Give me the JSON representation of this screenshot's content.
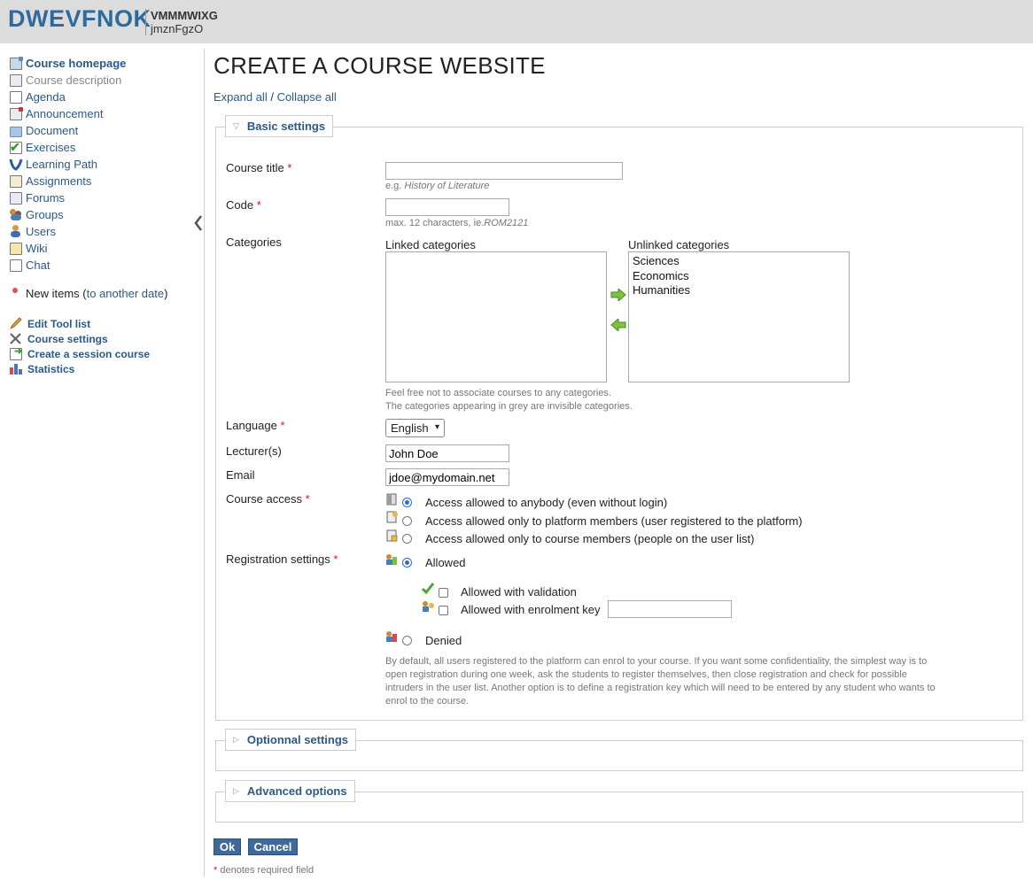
{
  "header": {
    "brand": "DWEVFNOK",
    "course_code": "VMMMWIXG",
    "course_name": "jmznFgzO"
  },
  "sidebar": {
    "tools": [
      {
        "label": "Course homepage",
        "icon": "home-icon"
      },
      {
        "label": "Course description",
        "icon": "description-icon"
      },
      {
        "label": "Agenda",
        "icon": "calendar-icon"
      },
      {
        "label": "Announcement",
        "icon": "announcement-icon"
      },
      {
        "label": "Document",
        "icon": "folder-icon"
      },
      {
        "label": "Exercises",
        "icon": "checkmark-icon"
      },
      {
        "label": "Learning Path",
        "icon": "learning-path-icon"
      },
      {
        "label": "Assignments",
        "icon": "assignment-icon"
      },
      {
        "label": "Forums",
        "icon": "forum-icon"
      },
      {
        "label": "Groups",
        "icon": "groups-icon"
      },
      {
        "label": "Users",
        "icon": "user-icon"
      },
      {
        "label": "Wiki",
        "icon": "wiki-icon"
      },
      {
        "label": "Chat",
        "icon": "chat-icon"
      }
    ],
    "new_items_label": "New items (",
    "new_items_link": "to another date",
    "new_items_close": ")",
    "admin": [
      {
        "label": "Edit Tool list",
        "icon": "pencil-icon"
      },
      {
        "label": "Course settings",
        "icon": "tools-icon"
      },
      {
        "label": "Create a session course",
        "icon": "session-course-icon"
      },
      {
        "label": "Statistics",
        "icon": "statistics-icon"
      }
    ]
  },
  "main": {
    "title": "CREATE A COURSE WEBSITE",
    "expand_all": "Expand all",
    "separator": " / ",
    "collapse_all": "Collapse all",
    "sections": {
      "basic": "Basic settings",
      "optional": "Optionnal settings",
      "advanced": "Advanced options"
    },
    "required_mark": "*",
    "fields": {
      "course_title": {
        "label": "Course title",
        "value": "",
        "hint_prefix": "e.g. ",
        "hint_example": "History of Literature"
      },
      "code": {
        "label": "Code",
        "value": "",
        "hint_prefix": "max. 12 characters, ie.",
        "hint_example": "ROM2121"
      },
      "categories": {
        "label": "Categories",
        "linked_label": "Linked categories",
        "unlinked_label": "Unlinked categories",
        "linked": [],
        "unlinked": [
          "Sciences",
          "Economics",
          "Humanities"
        ],
        "hint1": "Feel free not to associate courses to any categories.",
        "hint2": "The categories appearing in grey are invisible categories."
      },
      "language": {
        "label": "Language",
        "value": "English"
      },
      "lecturers": {
        "label": "Lecturer(s)",
        "value": "John Doe"
      },
      "email": {
        "label": "Email",
        "value": "jdoe@mydomain.net"
      },
      "course_access": {
        "label": "Course access",
        "options": [
          {
            "label": "Access allowed to anybody (even without login)",
            "checked": true
          },
          {
            "label": "Access allowed only to platform members (user registered to the platform)",
            "checked": false
          },
          {
            "label": "Access allowed only to course members (people on the user list)",
            "checked": false
          }
        ]
      },
      "registration": {
        "label": "Registration settings",
        "allowed": "Allowed",
        "allowed_checked": true,
        "with_validation": "Allowed with validation",
        "with_key": "Allowed with enrolment key",
        "key_value": "",
        "denied": "Denied",
        "description": "By default, all users registered to the platform can enrol to your course. If you want some confidentiality, the simplest way is to open registration during one week, ask the students to register themselves, then close registration and check for possible intruders in the user list. Another option is to define a registration key which will need to be entered by any student who wants to enrol to the course."
      }
    },
    "ok_label": "Ok",
    "cancel_label": "Cancel",
    "required_note": "denotes required field"
  },
  "colors": {
    "brand": "#2e6a9e",
    "link": "#2a5a8a",
    "button": "#3d6a99",
    "required": "#d11111",
    "header_bg": "#dcdcdc"
  }
}
